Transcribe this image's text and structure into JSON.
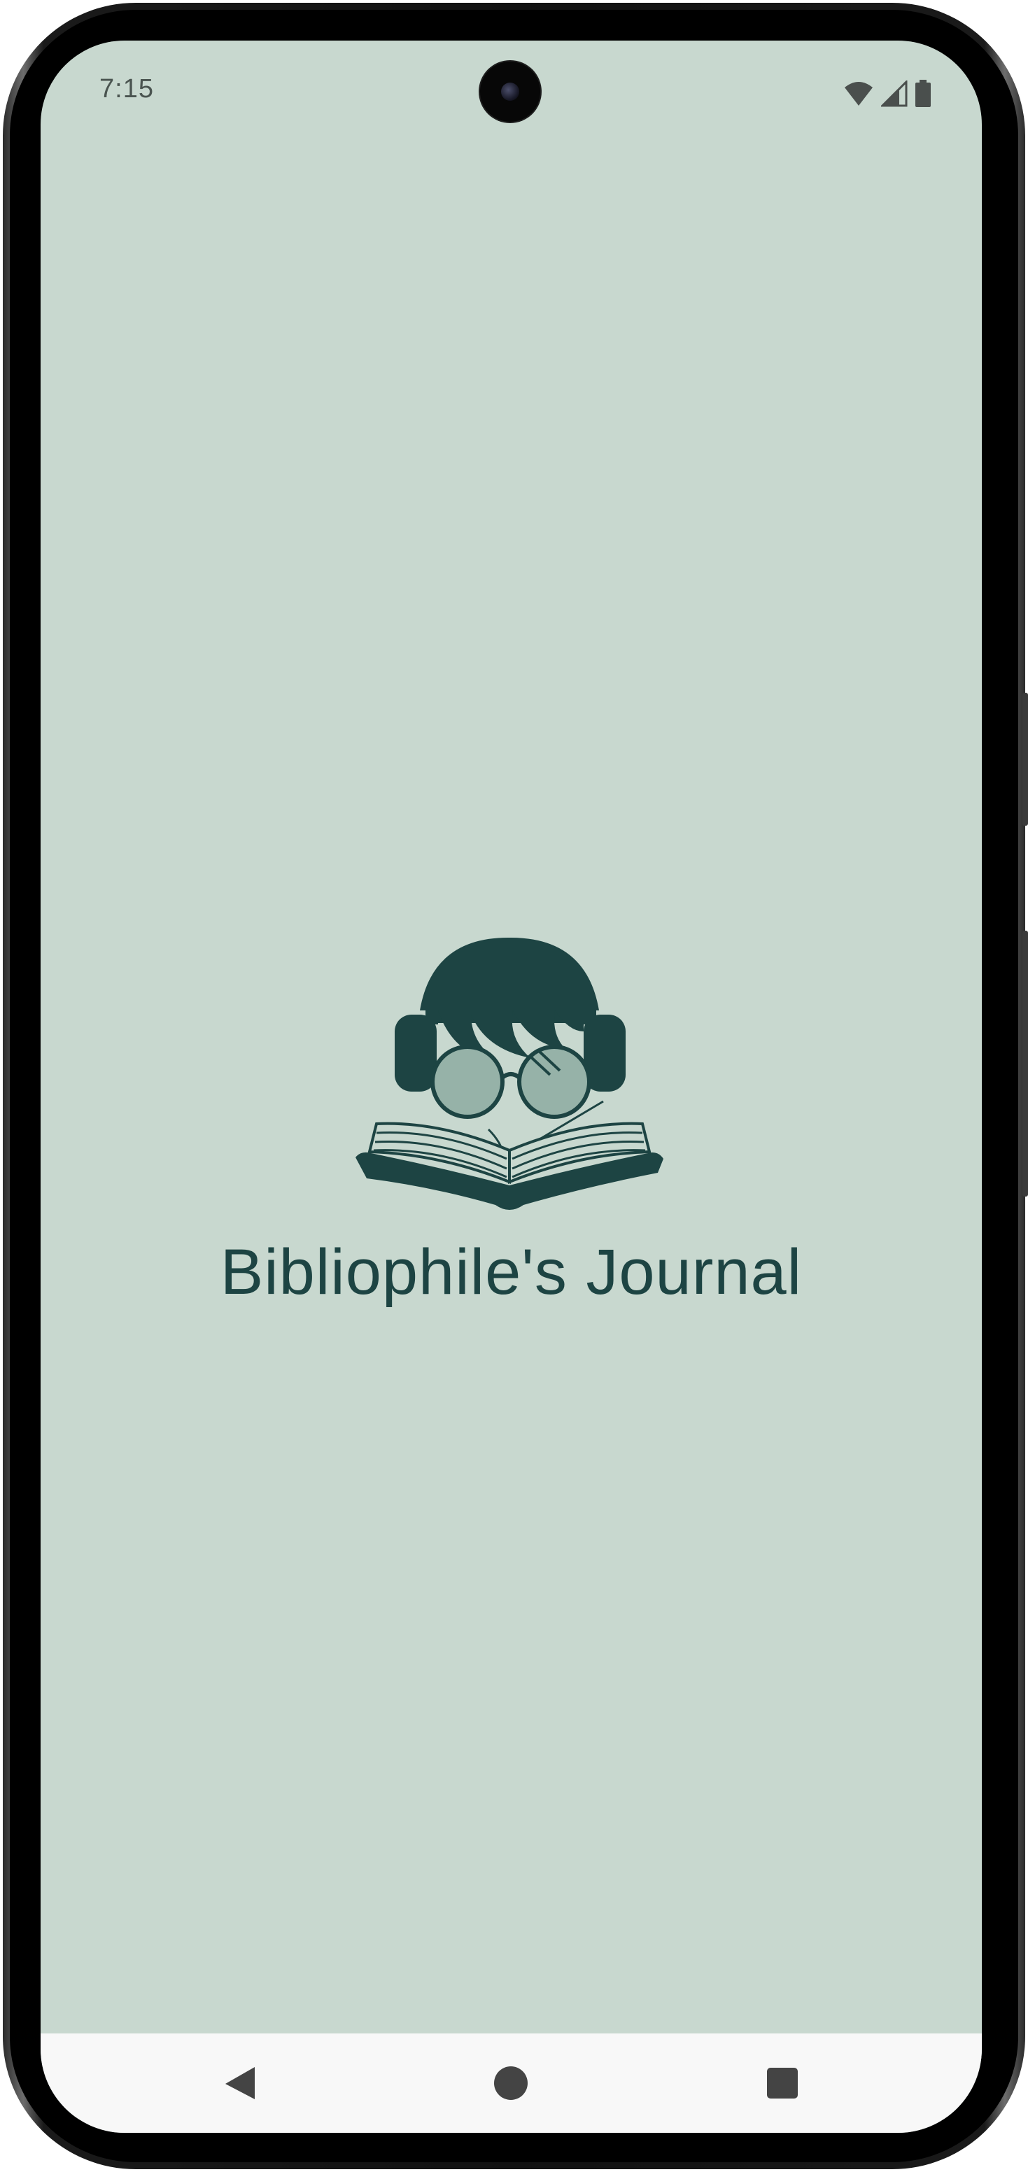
{
  "status_bar": {
    "time": "7:15",
    "icons": [
      "wifi-icon",
      "cellular-signal-icon",
      "battery-icon"
    ]
  },
  "splash": {
    "app_title": "Bibliophile's Journal",
    "logo": "reader-with-glasses-and-open-book-logo"
  },
  "nav_bar": {
    "buttons": [
      "back-icon",
      "home-icon",
      "recents-icon"
    ]
  },
  "colors": {
    "background": "#c8d8cf",
    "primary": "#1d4443",
    "glasses_fill": "#96b2a8",
    "nav_bar": "#f8f8f8",
    "nav_icons": "#444444"
  }
}
